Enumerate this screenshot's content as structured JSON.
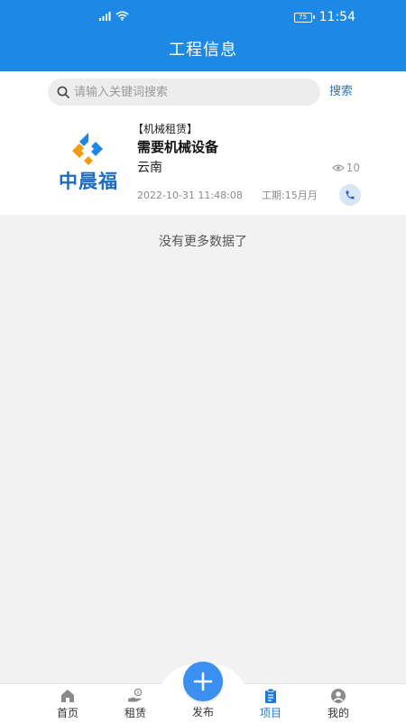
{
  "status_bar": {
    "battery": "75",
    "time": "11:54"
  },
  "header": {
    "title": "工程信息"
  },
  "search": {
    "placeholder": "请输入关键词搜索",
    "value": "",
    "button_label": "搜索"
  },
  "project": {
    "logo_text": "中晨福",
    "category": "【机械租赁】",
    "title": "需要机械设备",
    "location": "云南",
    "views": "10",
    "date": "2022-10-31 11:48:08",
    "duration": "工期:15月月"
  },
  "list": {
    "no_more": "没有更多数据了"
  },
  "bottom_nav": {
    "items": [
      {
        "label": "首页",
        "icon": "home-icon",
        "active": false
      },
      {
        "label": "租赁",
        "icon": "rent-icon",
        "active": false
      },
      {
        "label": "发布",
        "icon": "plus-icon",
        "active": false
      },
      {
        "label": "项目",
        "icon": "clipboard-icon",
        "active": true
      },
      {
        "label": "我的",
        "icon": "user-icon",
        "active": false
      }
    ]
  },
  "colors": {
    "primary": "#1e88e5",
    "active_nav": "#1e7ad6",
    "fab": "#3b8ff0",
    "background": "#f2f2f2"
  }
}
